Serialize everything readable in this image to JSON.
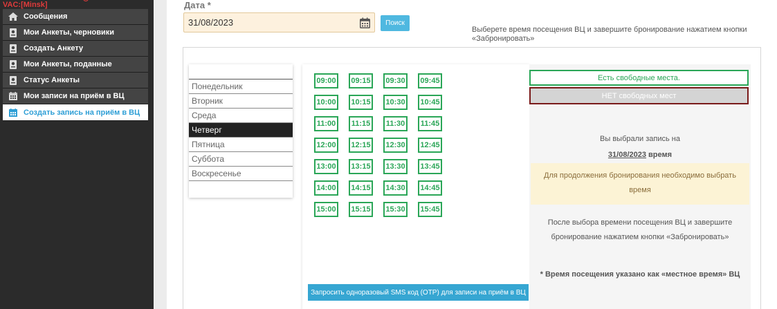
{
  "sidebar": {
    "vac_label": "VAC:[Minsk]",
    "items": [
      {
        "label": "Сообщения",
        "icon": "home-icon"
      },
      {
        "label": "Мои Анкеты, черновики",
        "icon": "passport-icon"
      },
      {
        "label": "Создать Анкету",
        "icon": "passport-icon"
      },
      {
        "label": "Мои Анкеты, поданные",
        "icon": "passport-icon"
      },
      {
        "label": "Статус Анкеты",
        "icon": "passport-icon"
      },
      {
        "label": "Мои записи на приём в ВЦ",
        "icon": "calendar-icon"
      },
      {
        "label": "Создать запись на приём в ВЦ",
        "icon": "calendar-icon"
      }
    ],
    "active_index": 6
  },
  "form": {
    "date_label": "Дата *",
    "date_value": "31/08/2023",
    "search_label": "Поиск",
    "hint": "Выберете время посещения ВЦ и завершите бронирование нажатием кнопки «Забронировать»"
  },
  "days": {
    "items": [
      "Понедельник",
      "Вторник",
      "Среда",
      "Четверг",
      "Пятница",
      "Суббота",
      "Воскресенье"
    ],
    "active": "Четверг"
  },
  "slots": [
    "09:00",
    "09:15",
    "09:30",
    "09:45",
    "10:00",
    "10:15",
    "10:30",
    "10:45",
    "11:00",
    "11:15",
    "11:30",
    "11:45",
    "12:00",
    "12:15",
    "12:30",
    "12:45",
    "13:00",
    "13:15",
    "13:30",
    "13:45",
    "14:00",
    "14:15",
    "14:30",
    "14:45",
    "15:00",
    "15:15",
    "15:30",
    "15:45"
  ],
  "sms_button": "Запросить одноразовый SMS код (OTP) для записи на приём в ВЦ",
  "legend": {
    "free": "Есть свободные места.",
    "none": "НЕТ свободных мест"
  },
  "selection": {
    "chosen_label": "Вы выбрали запись на",
    "chosen_date": "31/08/2023",
    "chosen_time_label": "время",
    "warning": "Для продолжения бронирования необходимо выбрать время",
    "after_text": "После выбора времени посещения ВЦ и завершите бронирование нажатием кнопки «Забронировать»",
    "note": "* Время посещения указано как «местное время» ВЦ"
  },
  "colors": {
    "slot_green": "#2aa657",
    "accent_blue": "#36a6d2",
    "sidebar_bg": "#2b2b2b",
    "warn_bg": "#fcf3d5"
  }
}
